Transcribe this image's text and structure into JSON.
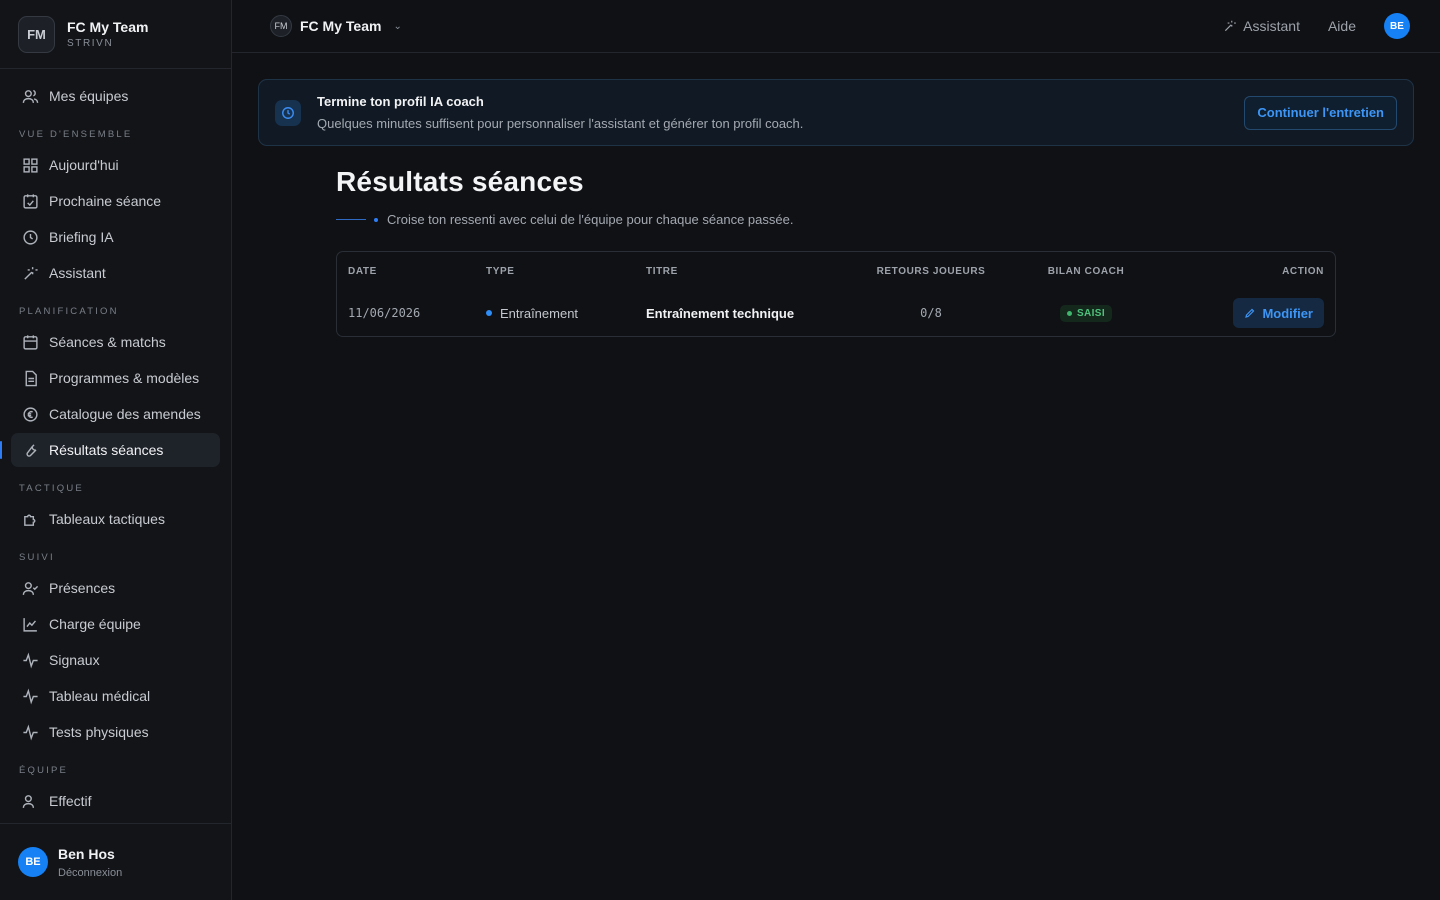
{
  "sidebar": {
    "logo_initials": "FM",
    "team_name": "FC My Team",
    "team_sub": "STRIVN",
    "top_item": {
      "label": "Mes équipes",
      "icon": "users-icon"
    },
    "sections": [
      {
        "label": "VUE D'ENSEMBLE",
        "items": [
          {
            "label": "Aujourd'hui",
            "icon": "grid-icon"
          },
          {
            "label": "Prochaine séance",
            "icon": "calendar-check-icon"
          },
          {
            "label": "Briefing IA",
            "icon": "clock-icon"
          },
          {
            "label": "Assistant",
            "icon": "sparkle-wand-icon"
          }
        ]
      },
      {
        "label": "PLANIFICATION",
        "items": [
          {
            "label": "Séances & matchs",
            "icon": "calendar-icon"
          },
          {
            "label": "Programmes & modèles",
            "icon": "document-icon"
          },
          {
            "label": "Catalogue des amendes",
            "icon": "euro-icon"
          },
          {
            "label": "Résultats séances",
            "icon": "wrench-icon",
            "active": true
          }
        ]
      },
      {
        "label": "TACTIQUE",
        "items": [
          {
            "label": "Tableaux tactiques",
            "icon": "puzzle-icon"
          }
        ]
      },
      {
        "label": "SUIVI",
        "items": [
          {
            "label": "Présences",
            "icon": "user-check-icon"
          },
          {
            "label": "Charge équipe",
            "icon": "line-chart-icon"
          },
          {
            "label": "Signaux",
            "icon": "activity-icon"
          },
          {
            "label": "Tableau médical",
            "icon": "activity-icon"
          },
          {
            "label": "Tests physiques",
            "icon": "activity-icon"
          }
        ]
      },
      {
        "label": "ÉQUIPE",
        "items": [
          {
            "label": "Effectif",
            "icon": "users-icon"
          }
        ]
      }
    ],
    "user": {
      "initials": "BE",
      "name": "Ben Hos",
      "logout": "Déconnexion"
    }
  },
  "topbar": {
    "team_initials": "FM",
    "team_name": "FC My Team",
    "assistant": "Assistant",
    "help": "Aide",
    "user_initials": "BE"
  },
  "banner": {
    "title": "Termine ton profil IA coach",
    "description": "Quelques minutes suffisent pour personnaliser l'assistant et générer ton profil coach.",
    "button": "Continuer l'entretien"
  },
  "page": {
    "title": "Résultats séances",
    "subtitle": "Croise ton ressenti avec celui de l'équipe pour chaque séance passée."
  },
  "table": {
    "headers": {
      "date": "DATE",
      "type": "TYPE",
      "title": "TITRE",
      "feedback": "RETOURS JOUEURS",
      "coach": "BILAN COACH",
      "action": "ACTION"
    },
    "rows": [
      {
        "date": "11/06/2026",
        "type": "Entraînement",
        "title": "Entraînement technique",
        "feedback": "0/8",
        "coach": "SAISI",
        "action": "Modifier"
      }
    ]
  },
  "colors": {
    "accent": "#2f7df6",
    "success": "#3fb56d",
    "background": "#0f1115"
  }
}
